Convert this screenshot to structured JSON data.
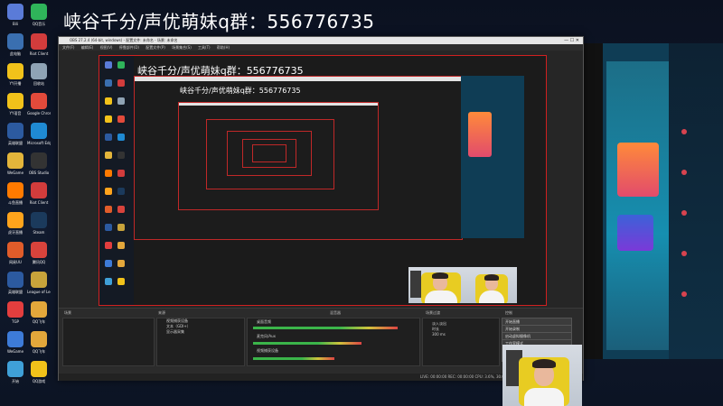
{
  "overlay": {
    "title": "峡谷千分/声优萌妹q群：556776735"
  },
  "desktop_icons": [
    {
      "label": "Bili",
      "color": "#5a7bd8"
    },
    {
      "label": "QQ音乐",
      "color": "#2fb45a"
    },
    {
      "label": "此电脑",
      "color": "#3a6fb0"
    },
    {
      "label": "Riot Client",
      "color": "#d23c3c"
    },
    {
      "label": "YY开播",
      "color": "#f1c21a"
    },
    {
      "label": "回收站",
      "color": "#8fa3b5"
    },
    {
      "label": "YY语音",
      "color": "#f1c21a"
    },
    {
      "label": "Google Chrome",
      "color": "#e24a3b"
    },
    {
      "label": "英雄联盟",
      "color": "#2c5aa0"
    },
    {
      "label": "Microsoft Edge",
      "color": "#1f8ad3"
    },
    {
      "label": "WeGame",
      "color": "#e3b53b"
    },
    {
      "label": "OBS Studio",
      "color": "#333333"
    },
    {
      "label": "斗鱼直播",
      "color": "#ff7a00"
    },
    {
      "label": "Riot Client",
      "color": "#d23c3c"
    },
    {
      "label": "虎牙直播",
      "color": "#ffa41c"
    },
    {
      "label": "Steam",
      "color": "#1b3a5c"
    },
    {
      "label": "网易UU",
      "color": "#e05c2a"
    },
    {
      "label": "腾讯QQ",
      "color": "#d8433c"
    },
    {
      "label": "英雄联盟",
      "color": "#2c5aa0"
    },
    {
      "label": "League of Legends",
      "color": "#c7a33b"
    },
    {
      "label": "TGP",
      "color": "#e33e3e"
    },
    {
      "label": "QQ飞车",
      "color": "#e3a73b"
    },
    {
      "label": "WeGame",
      "color": "#3d7bd8"
    },
    {
      "label": "QQ飞车",
      "color": "#e3a73b"
    },
    {
      "label": "开始",
      "color": "#3fa0d8"
    },
    {
      "label": "QQ游戏",
      "color": "#f1c21a"
    }
  ],
  "obs": {
    "window_title": "OBS 27.2.4 (64-bit, windows) - 配置文件: 未命名 - 场景: 未命名",
    "menu": [
      "文件(F)",
      "编辑(E)",
      "视图(V)",
      "停靠部件(D)",
      "配置文件(P)",
      "场景集合(S)",
      "工具(T)",
      "帮助(H)"
    ],
    "preview_title": "峡谷千分/声优萌妹q群：556776735",
    "nested_title": "峡谷千分/声优萌妹q群：556776735",
    "dock": {
      "scenes_header": "场景",
      "sources_header": "来源",
      "mixer_header": "混音器",
      "transitions_header": "场景过渡",
      "controls_header": "控制",
      "sources": [
        "视频捕获设备",
        "文本（GDI+）",
        "显示器采集"
      ],
      "controls": [
        "开始直播",
        "开始录制",
        "启动虚拟摄像机",
        "工作室模式",
        "设置",
        "退出"
      ],
      "transition_value": "淡入淡出",
      "duration_label": "时长",
      "duration_value": "300 ms",
      "mixer_tracks": [
        "桌面音频",
        "麦克风/Aux",
        "视频捕获设备"
      ],
      "status": "LIVE: 00:00:00   REC: 00:00:00   CPU: 3.6%, 30.00 fps"
    }
  }
}
